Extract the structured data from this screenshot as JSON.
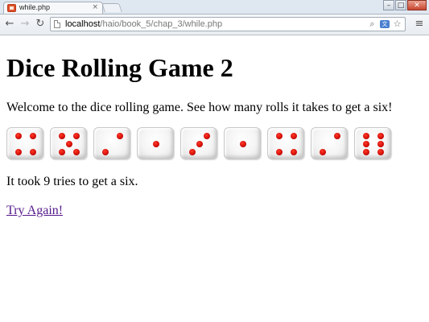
{
  "browser": {
    "tab_title": "while.php",
    "tab_close_glyph": "×",
    "url_host": "localhost",
    "url_path": "/haio/book_5/chap_3/while.php",
    "icons": [
      "back-arrow-icon",
      "forward-arrow-icon",
      "reload-icon",
      "page-icon",
      "search-icon",
      "translate-icon",
      "star-icon",
      "menu-icon"
    ],
    "window_buttons": [
      "minimize",
      "maximize",
      "close"
    ]
  },
  "page": {
    "heading": "Dice Rolling Game 2",
    "intro": "Welcome to the dice rolling game. See how many rolls it takes to get a six!",
    "rolls": [
      4,
      5,
      2,
      1,
      3,
      1,
      4,
      2,
      6
    ],
    "pip_color": "#d40f08",
    "result": "It took 9 tries to get a six.",
    "try_again": "Try Again!"
  }
}
